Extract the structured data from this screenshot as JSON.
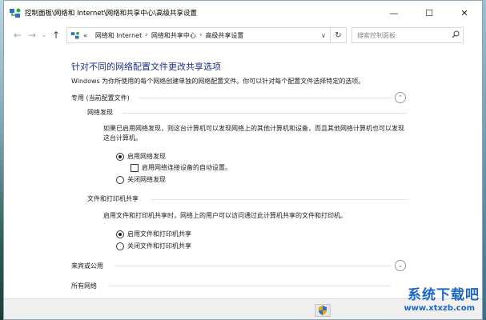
{
  "window": {
    "title": "控制面板\\网络和 Internet\\网络和共享中心\\高级共享设置",
    "minimize_glyph": "—",
    "maximize_glyph": "☐",
    "close_glyph": "✕"
  },
  "address": {
    "back_glyph": "←",
    "forward_glyph": "→",
    "recent_glyph": "⌄",
    "up_glyph": "↑",
    "overflow": "«",
    "crumbs": [
      "网络和 Internet",
      "网络和共享中心",
      "高级共享设置"
    ],
    "crumb_sep": "›",
    "dropdown_glyph": "∨",
    "refresh_glyph": "↻",
    "search_placeholder": "搜索控制面板",
    "search_glyph": "⌕"
  },
  "page": {
    "heading": "针对不同的网络配置文件更改共享选项",
    "description": "Windows 为你所使用的每个网络创建单独的网络配置文件。你可以针对每个配置文件选择特定的选项。",
    "profiles": [
      {
        "label": "专用 (当前配置文件)",
        "state": "expanded",
        "chevron": "⌃"
      },
      {
        "label": "来宾或公用",
        "state": "collapsed",
        "chevron": "⌄"
      },
      {
        "label": "所有网络",
        "state": "collapsed",
        "chevron": "⌄"
      }
    ],
    "network_discovery": {
      "title": "网络发现",
      "text": "如果已启用网络发现，则这台计算机可以发现网络上的其他计算机和设备，而且其他网络计算机也可以发现这台计算机。",
      "opt_on": "启用网络发现",
      "opt_auto": "启用网络连接设备的自动设置。",
      "opt_off": "关闭网络发现",
      "selected": "on",
      "auto_checked": false
    },
    "file_sharing": {
      "title": "文件和打印机共享",
      "text": "启用文件和打印机共享时，网络上的用户可以访问通过此计算机共享的文件和打印机。",
      "opt_on": "启用文件和打印机共享",
      "opt_off": "关闭文件和打印机共享",
      "selected": "on"
    }
  },
  "watermark": {
    "title": "系统下载吧",
    "url": "www.xtxzb.com"
  },
  "colors": {
    "heading": "#1e3287",
    "watermark": "#1d67c2"
  }
}
